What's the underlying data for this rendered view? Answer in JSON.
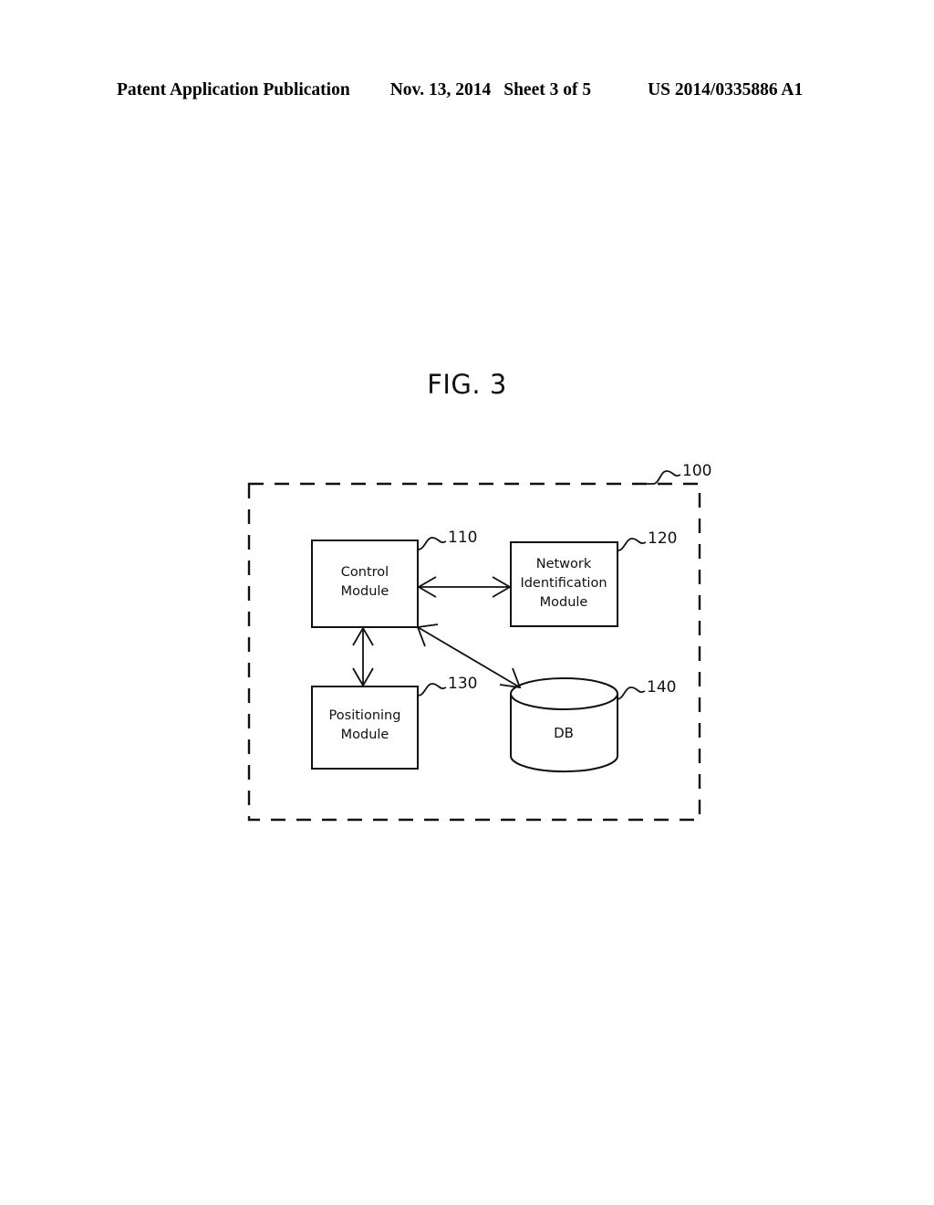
{
  "header": {
    "publication": "Patent Application Publication",
    "date": "Nov. 13, 2014",
    "sheet": "Sheet 3 of 5",
    "patent_number": "US 2014/0335886 A1"
  },
  "figure": {
    "title": "FIG. 3",
    "system_ref": "100",
    "blocks": [
      {
        "ref": "110",
        "line1": "Control",
        "line2": "Module",
        "line3": ""
      },
      {
        "ref": "120",
        "line1": "Network",
        "line2": "Identification",
        "line3": "Module"
      },
      {
        "ref": "130",
        "line1": "Positioning",
        "line2": "Module",
        "line3": ""
      },
      {
        "ref": "140",
        "line1": "DB",
        "line2": "",
        "line3": ""
      }
    ],
    "colors": {
      "stroke": "#111111",
      "background": "#ffffff"
    }
  }
}
